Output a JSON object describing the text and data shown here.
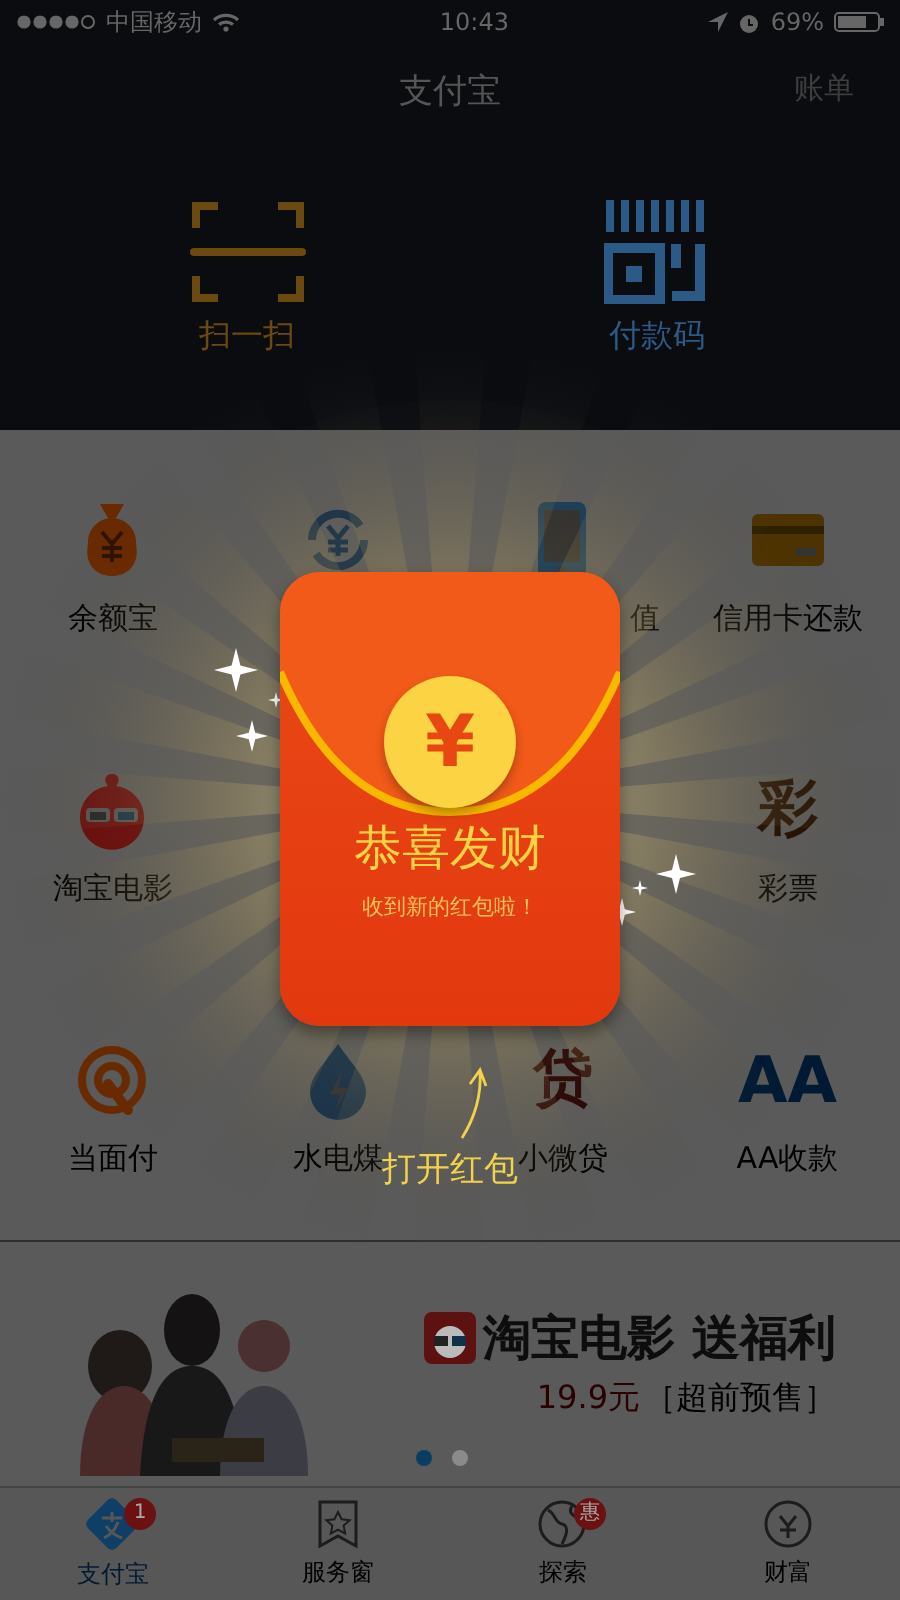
{
  "status_bar": {
    "carrier": "中国移动",
    "time": "10:43",
    "battery": "69%"
  },
  "nav_bar": {
    "title": "支付宝",
    "action": "账单"
  },
  "quick_actions": [
    {
      "kind": "scan",
      "label": "扫一扫"
    },
    {
      "kind": "paycode",
      "label": "付款码"
    }
  ],
  "grid": [
    {
      "kind": "moneybag",
      "label": "余额宝"
    },
    {
      "kind": "exchange"
    },
    {
      "kind": "phone",
      "label": "值",
      "cut": true
    },
    {
      "kind": "card",
      "label": "信用卡还款"
    },
    {
      "kind": "movie",
      "label": "淘宝电影"
    },
    {
      "kind": "covered"
    },
    {
      "kind": "covered"
    },
    {
      "kind": "glyph",
      "glyph": "彩",
      "label": "彩票"
    },
    {
      "kind": "facepay",
      "label": "当面付"
    },
    {
      "kind": "utility",
      "label": "水电煤"
    },
    {
      "kind": "glyph",
      "glyph": "贷",
      "label": "小微贷"
    },
    {
      "kind": "glyph",
      "glyph": "AA",
      "label": "AA收款"
    }
  ],
  "banner": {
    "kind": "picture",
    "title": "淘宝电影 送福利",
    "price": "19.9元",
    "tag": "［超前预售］",
    "dots": [
      {
        "selected": true
      },
      {
        "selected": false
      }
    ]
  },
  "tab_bar": [
    {
      "label": "支付宝",
      "selected": true,
      "badge": "1"
    },
    {
      "label": "服务窗",
      "selected": false
    },
    {
      "label": "探索",
      "selected": false,
      "badge": "惠"
    },
    {
      "label": "财富",
      "selected": false
    }
  ],
  "red_packet": {
    "title": "恭喜发财",
    "subtitle": "收到新的红包啦！",
    "currency": "¥",
    "open_hint": "打开红包"
  }
}
